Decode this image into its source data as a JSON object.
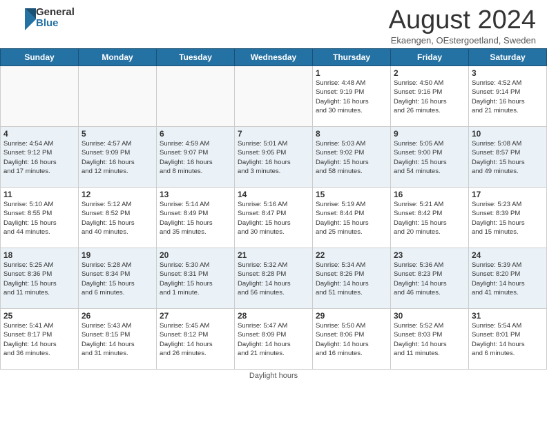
{
  "header": {
    "logo_general": "General",
    "logo_blue": "Blue",
    "title": "August 2024",
    "subtitle": "Ekaengen, OEstergoetland, Sweden"
  },
  "days_of_week": [
    "Sunday",
    "Monday",
    "Tuesday",
    "Wednesday",
    "Thursday",
    "Friday",
    "Saturday"
  ],
  "weeks": [
    {
      "row_class": "normal",
      "days": [
        {
          "num": "",
          "info": ""
        },
        {
          "num": "",
          "info": ""
        },
        {
          "num": "",
          "info": ""
        },
        {
          "num": "",
          "info": ""
        },
        {
          "num": "1",
          "info": "Sunrise: 4:48 AM\nSunset: 9:19 PM\nDaylight: 16 hours\nand 30 minutes."
        },
        {
          "num": "2",
          "info": "Sunrise: 4:50 AM\nSunset: 9:16 PM\nDaylight: 16 hours\nand 26 minutes."
        },
        {
          "num": "3",
          "info": "Sunrise: 4:52 AM\nSunset: 9:14 PM\nDaylight: 16 hours\nand 21 minutes."
        }
      ]
    },
    {
      "row_class": "alt",
      "days": [
        {
          "num": "4",
          "info": "Sunrise: 4:54 AM\nSunset: 9:12 PM\nDaylight: 16 hours\nand 17 minutes."
        },
        {
          "num": "5",
          "info": "Sunrise: 4:57 AM\nSunset: 9:09 PM\nDaylight: 16 hours\nand 12 minutes."
        },
        {
          "num": "6",
          "info": "Sunrise: 4:59 AM\nSunset: 9:07 PM\nDaylight: 16 hours\nand 8 minutes."
        },
        {
          "num": "7",
          "info": "Sunrise: 5:01 AM\nSunset: 9:05 PM\nDaylight: 16 hours\nand 3 minutes."
        },
        {
          "num": "8",
          "info": "Sunrise: 5:03 AM\nSunset: 9:02 PM\nDaylight: 15 hours\nand 58 minutes."
        },
        {
          "num": "9",
          "info": "Sunrise: 5:05 AM\nSunset: 9:00 PM\nDaylight: 15 hours\nand 54 minutes."
        },
        {
          "num": "10",
          "info": "Sunrise: 5:08 AM\nSunset: 8:57 PM\nDaylight: 15 hours\nand 49 minutes."
        }
      ]
    },
    {
      "row_class": "normal",
      "days": [
        {
          "num": "11",
          "info": "Sunrise: 5:10 AM\nSunset: 8:55 PM\nDaylight: 15 hours\nand 44 minutes."
        },
        {
          "num": "12",
          "info": "Sunrise: 5:12 AM\nSunset: 8:52 PM\nDaylight: 15 hours\nand 40 minutes."
        },
        {
          "num": "13",
          "info": "Sunrise: 5:14 AM\nSunset: 8:49 PM\nDaylight: 15 hours\nand 35 minutes."
        },
        {
          "num": "14",
          "info": "Sunrise: 5:16 AM\nSunset: 8:47 PM\nDaylight: 15 hours\nand 30 minutes."
        },
        {
          "num": "15",
          "info": "Sunrise: 5:19 AM\nSunset: 8:44 PM\nDaylight: 15 hours\nand 25 minutes."
        },
        {
          "num": "16",
          "info": "Sunrise: 5:21 AM\nSunset: 8:42 PM\nDaylight: 15 hours\nand 20 minutes."
        },
        {
          "num": "17",
          "info": "Sunrise: 5:23 AM\nSunset: 8:39 PM\nDaylight: 15 hours\nand 15 minutes."
        }
      ]
    },
    {
      "row_class": "alt",
      "days": [
        {
          "num": "18",
          "info": "Sunrise: 5:25 AM\nSunset: 8:36 PM\nDaylight: 15 hours\nand 11 minutes."
        },
        {
          "num": "19",
          "info": "Sunrise: 5:28 AM\nSunset: 8:34 PM\nDaylight: 15 hours\nand 6 minutes."
        },
        {
          "num": "20",
          "info": "Sunrise: 5:30 AM\nSunset: 8:31 PM\nDaylight: 15 hours\nand 1 minute."
        },
        {
          "num": "21",
          "info": "Sunrise: 5:32 AM\nSunset: 8:28 PM\nDaylight: 14 hours\nand 56 minutes."
        },
        {
          "num": "22",
          "info": "Sunrise: 5:34 AM\nSunset: 8:26 PM\nDaylight: 14 hours\nand 51 minutes."
        },
        {
          "num": "23",
          "info": "Sunrise: 5:36 AM\nSunset: 8:23 PM\nDaylight: 14 hours\nand 46 minutes."
        },
        {
          "num": "24",
          "info": "Sunrise: 5:39 AM\nSunset: 8:20 PM\nDaylight: 14 hours\nand 41 minutes."
        }
      ]
    },
    {
      "row_class": "normal",
      "days": [
        {
          "num": "25",
          "info": "Sunrise: 5:41 AM\nSunset: 8:17 PM\nDaylight: 14 hours\nand 36 minutes."
        },
        {
          "num": "26",
          "info": "Sunrise: 5:43 AM\nSunset: 8:15 PM\nDaylight: 14 hours\nand 31 minutes."
        },
        {
          "num": "27",
          "info": "Sunrise: 5:45 AM\nSunset: 8:12 PM\nDaylight: 14 hours\nand 26 minutes."
        },
        {
          "num": "28",
          "info": "Sunrise: 5:47 AM\nSunset: 8:09 PM\nDaylight: 14 hours\nand 21 minutes."
        },
        {
          "num": "29",
          "info": "Sunrise: 5:50 AM\nSunset: 8:06 PM\nDaylight: 14 hours\nand 16 minutes."
        },
        {
          "num": "30",
          "info": "Sunrise: 5:52 AM\nSunset: 8:03 PM\nDaylight: 14 hours\nand 11 minutes."
        },
        {
          "num": "31",
          "info": "Sunrise: 5:54 AM\nSunset: 8:01 PM\nDaylight: 14 hours\nand 6 minutes."
        }
      ]
    }
  ],
  "footer": {
    "daylight_label": "Daylight hours"
  }
}
